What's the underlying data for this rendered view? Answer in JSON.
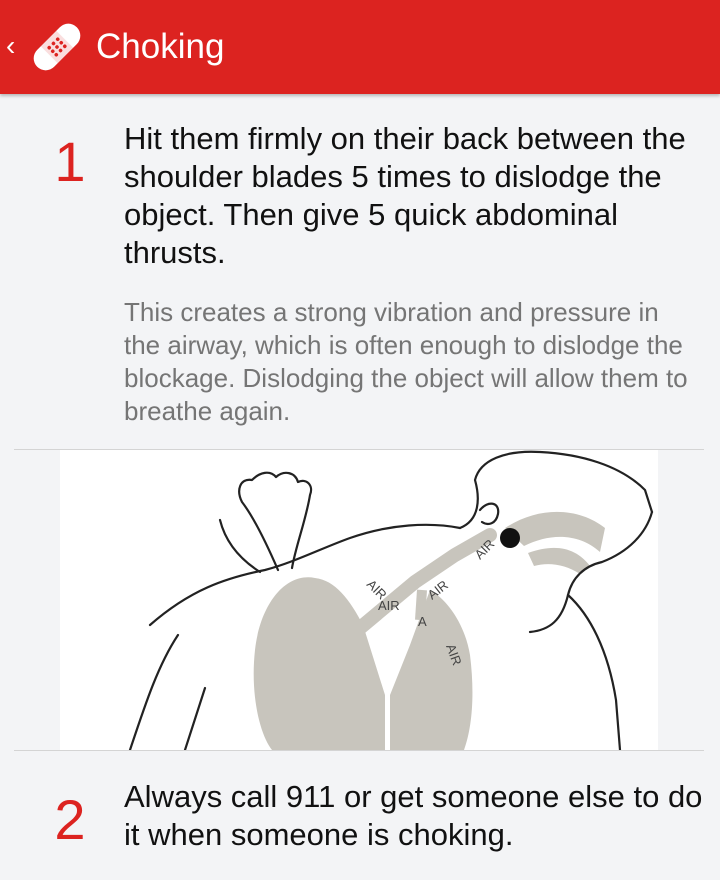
{
  "appbar": {
    "title": "Choking",
    "back_icon": "chevron-left-icon",
    "logo_icon": "bandage-icon",
    "background": "#dc2320"
  },
  "steps": [
    {
      "number": "1",
      "text": "Hit them firmly on their back between the shoulder blades 5 times to dislodge the object. Then give 5 quick abdominal thrusts.",
      "detail": "This creates a strong vibration and pressure in the airway, which is often enough to dislodge the blockage. Dislodging the object will allow them to breathe again."
    },
    {
      "number": "2",
      "text": "Always call 911 or get someone else to do it when someone is choking."
    }
  ],
  "illustration": {
    "labels": [
      "AIR",
      "AIR",
      "AIR",
      "AIR",
      "AIR",
      "A"
    ]
  },
  "colors": {
    "accent": "#dc2320",
    "detail_text": "#757575",
    "lungs": "#c8c5bd"
  }
}
